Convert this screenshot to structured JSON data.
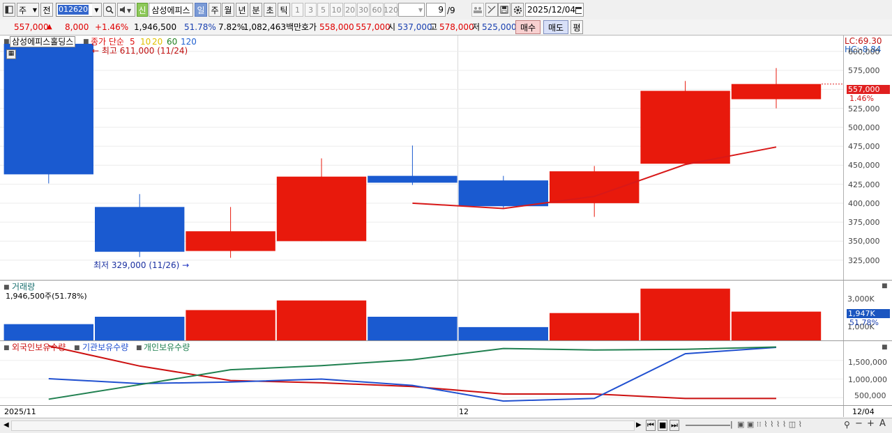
{
  "toolbar": {
    "week_label": "주",
    "prev_label": "전",
    "code": "012620",
    "new_label": "신",
    "stock_name": "삼성에피스",
    "periods": [
      "일",
      "주",
      "월",
      "년",
      "분",
      "초",
      "틱"
    ],
    "active_period": "일",
    "intervals": [
      "1",
      "3",
      "5",
      "10",
      "20",
      "30",
      "60",
      "120"
    ],
    "page_count": "9",
    "page_total": "/9",
    "date": "2025/12/04"
  },
  "quote": {
    "price": "557,000",
    "change": "8,000",
    "change_pct": "+1.46%",
    "volume": "1,946,500",
    "vol_pct": "51.78%",
    "turnover_pct": "7.82%",
    "amount": "1,082,463백만",
    "bid_label": "호가",
    "ask": "558,000",
    "bid": "557,000",
    "open_label": "시",
    "open": "537,000",
    "high_label": "고",
    "high": "578,000",
    "low_label": "저",
    "low": "525,000",
    "buy_label": "매수",
    "sell_label": "매도",
    "even_label": "평"
  },
  "price_panel": {
    "name": "삼성에피스홀딩스",
    "ma_label": "종가 단순",
    "ma_periods": [
      "5",
      "10",
      "20",
      "60",
      "120"
    ],
    "ma_colors": [
      "#e01010",
      "#e0c000",
      "#e0c000",
      "#208020",
      "#2060d0"
    ],
    "high_note": "최고 611,000 (11/24)",
    "low_note": "최저 329,000 (11/26)",
    "lc": "LC:69.30",
    "hc": "HC:-8.84",
    "last_price": "557,000",
    "last_pct": "1.46%",
    "y_ticks": [
      "600,000",
      "575,000",
      "550,000",
      "525,000",
      "500,000",
      "475,000",
      "450,000",
      "425,000",
      "400,000",
      "375,000",
      "350,000",
      "325,000"
    ]
  },
  "volume_panel": {
    "title": "거래량",
    "value": "1,946,500주(51.78%)",
    "y_ticks": [
      "3,000K",
      "1,000K"
    ],
    "last_vol": "1,947K",
    "last_pct": "51.78%"
  },
  "holding_panel": {
    "legend": [
      "외국인보유수량",
      "기관보유수량",
      "개인보유수량"
    ],
    "legend_colors": [
      "#cc1010",
      "#2050d0",
      "#208050"
    ],
    "y_ticks": [
      "1,500,000",
      "1,000,000",
      "500,000"
    ]
  },
  "x_axis": {
    "left": "2025/11",
    "mid": "12",
    "right": "12/04"
  },
  "chart_data": [
    {
      "type": "candlestick",
      "title": "삼성에피스홀딩스",
      "ylim": [
        310000,
        620000
      ],
      "candles": [
        {
          "open": 610000,
          "close": 438000,
          "high": 611000,
          "low": 426000,
          "color": "blue"
        },
        {
          "open": 395000,
          "close": 336000,
          "high": 412000,
          "low": 329000,
          "color": "blue"
        },
        {
          "open": 337000,
          "close": 363000,
          "high": 395000,
          "low": 328000,
          "color": "red"
        },
        {
          "open": 350000,
          "close": 435000,
          "high": 459000,
          "low": 350000,
          "color": "red"
        },
        {
          "open": 436000,
          "close": 427000,
          "high": 476000,
          "low": 424000,
          "color": "blue"
        },
        {
          "open": 430000,
          "close": 396000,
          "high": 436000,
          "low": 394000,
          "color": "blue"
        },
        {
          "open": 400000,
          "close": 442000,
          "high": 449000,
          "low": 382000,
          "color": "red"
        },
        {
          "open": 452000,
          "close": 548000,
          "high": 561000,
          "low": 452000,
          "color": "red"
        },
        {
          "open": 537000,
          "close": 557000,
          "high": 578000,
          "low": 525000,
          "color": "red"
        }
      ],
      "ma5": [
        null,
        null,
        null,
        null,
        400000,
        393000,
        409000,
        451000,
        474000
      ]
    },
    {
      "type": "bar",
      "title": "거래량",
      "ylim": [
        0,
        4000000
      ],
      "values": [
        1100000,
        1600000,
        2050000,
        2700000,
        1600000,
        900000,
        1850000,
        3500000,
        1946500
      ],
      "colors": [
        "blue",
        "blue",
        "red",
        "red",
        "blue",
        "blue",
        "red",
        "red",
        "red"
      ]
    },
    {
      "type": "line",
      "ylim": [
        300000,
        2000000
      ],
      "series": [
        {
          "name": "외국인보유수량",
          "values": [
            1890000,
            1350000,
            960000,
            900000,
            800000,
            600000,
            600000,
            480000,
            480000
          ]
        },
        {
          "name": "기관보유수량",
          "values": [
            1010000,
            880000,
            920000,
            1000000,
            830000,
            410000,
            480000,
            1680000,
            1850000
          ]
        },
        {
          "name": "개인보유수량",
          "values": [
            460000,
            850000,
            1250000,
            1360000,
            1520000,
            1820000,
            1780000,
            1800000,
            1860000
          ]
        }
      ]
    }
  ]
}
